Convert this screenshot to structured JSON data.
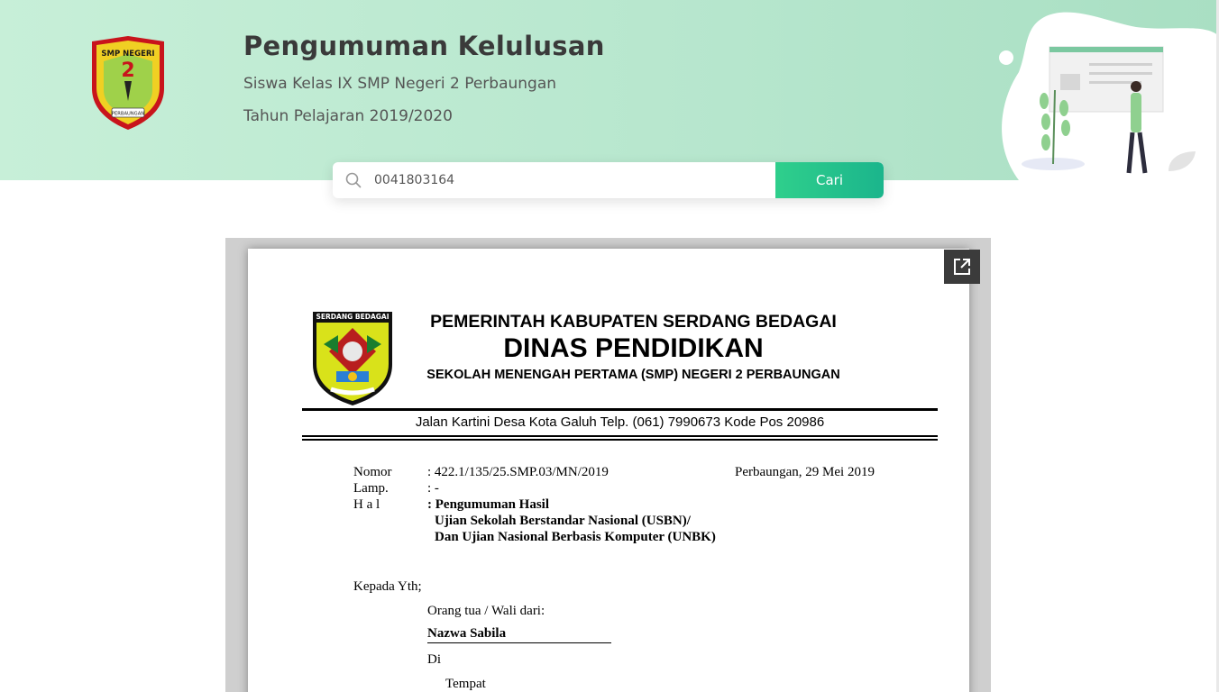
{
  "header": {
    "title": "Pengumuman Kelulusan",
    "subtitle_line1": "Siswa Kelas IX SMP Negeri 2 Perbaungan",
    "subtitle_line2": "Tahun Pelajaran 2019/2020",
    "logo_text_top": "SMP NEGERI",
    "logo_number": "2",
    "logo_text_bottom": "PERBAUNGAN"
  },
  "search": {
    "value": "0041803164",
    "button_label": "Cari",
    "icon": "search-icon"
  },
  "viewer": {
    "popout_icon": "open-in-new-icon",
    "letterhead": {
      "logo_caption": "SERDANG BEDAGAI",
      "line1": "PEMERINTAH KABUPATEN SERDANG BEDAGAI",
      "line2": "DINAS PENDIDIKAN",
      "line3": "SEKOLAH MENENGAH PERTAMA (SMP) NEGERI 2 PERBAUNGAN",
      "address": "Jalan Kartini Desa Kota Galuh Telp. (061) 7990673 Kode Pos 20986"
    },
    "letter": {
      "nomor_label": "Nomor",
      "nomor_value": ": 422.1/135/25.SMP.03/MN/2019",
      "place_date": "Perbaungan, 29 Mei 2019",
      "lamp_label": "Lamp.",
      "lamp_value": ": -",
      "hal_label": "H a l",
      "hal_value_line1": ": Pengumuman Hasil",
      "hal_value_line2": "Ujian Sekolah Berstandar Nasional (USBN)/",
      "hal_value_line3": "Dan Ujian Nasional Berbasis Komputer (UNBK)",
      "kepada": "Kepada Yth;",
      "orang_tua": "Orang tua / Wali dari:",
      "student_name": "Nazwa Sabila",
      "di": "Di",
      "tempat": "Tempat"
    }
  },
  "colors": {
    "header_bg": "#b6e6cd",
    "button_green": "#1bb58c",
    "title_text": "#3a3a3a"
  }
}
